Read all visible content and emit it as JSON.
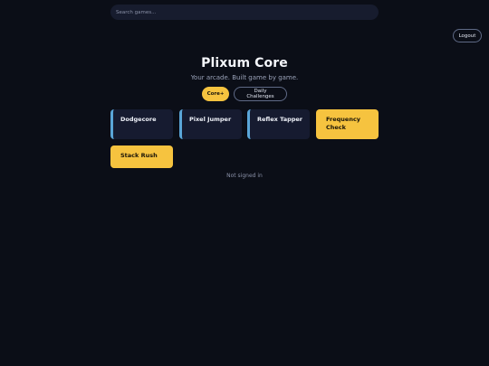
{
  "search": {
    "placeholder": "Search games..."
  },
  "header": {
    "logout_label": "Logout"
  },
  "hero": {
    "title": "Plixum Core",
    "tagline": "Your arcade. Built game by game."
  },
  "filters": [
    {
      "label": "Core+",
      "active": true
    },
    {
      "label": "Daily Challenges",
      "active": false
    }
  ],
  "games": [
    {
      "title": "Dodgecore",
      "featured": false
    },
    {
      "title": "Pixel Jumper",
      "featured": false
    },
    {
      "title": "Reflex Tapper",
      "featured": false
    },
    {
      "title": "Frequency Check",
      "featured": true
    },
    {
      "title": "Stack Rush",
      "featured": true
    }
  ],
  "status": "Not signed in",
  "colors": {
    "background": "#0b0e17",
    "accent": "#f6c33f",
    "card": "#161b30",
    "card_edge": "#5aa6d8"
  }
}
